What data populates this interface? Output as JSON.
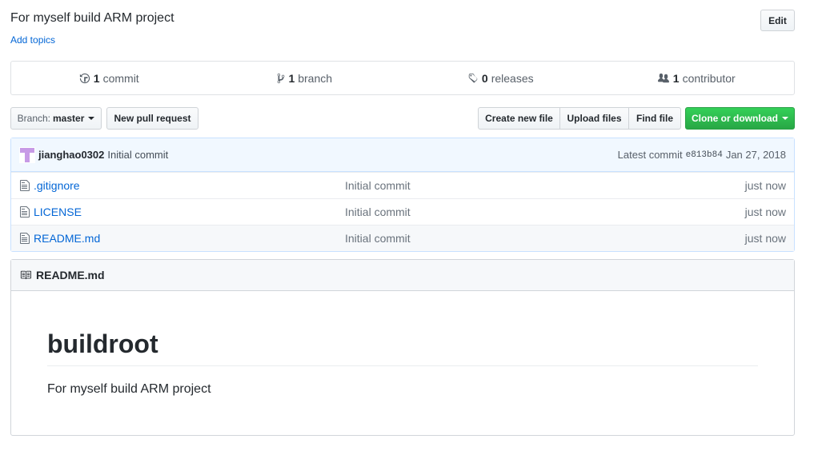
{
  "repo": {
    "description": "For myself build ARM project",
    "add_topics": "Add topics",
    "edit_label": "Edit"
  },
  "summary": {
    "commits_count": "1",
    "commits_label": "commit",
    "branches_count": "1",
    "branches_label": "branch",
    "releases_count": "0",
    "releases_label": "releases",
    "contributors_count": "1",
    "contributors_label": "contributor"
  },
  "toolbar": {
    "branch_prefix": "Branch:",
    "branch_name": "master",
    "new_pr": "New pull request",
    "create_file": "Create new file",
    "upload_files": "Upload files",
    "find_file": "Find file",
    "clone": "Clone or download"
  },
  "latest_commit": {
    "author": "jianghao0302",
    "message": "Initial commit",
    "label": "Latest commit",
    "sha": "e813b84",
    "date": "Jan 27, 2018"
  },
  "files": [
    {
      "name": ".gitignore",
      "message": "Initial commit",
      "age": "just now"
    },
    {
      "name": "LICENSE",
      "message": "Initial commit",
      "age": "just now"
    },
    {
      "name": "README.md",
      "message": "Initial commit",
      "age": "just now"
    }
  ],
  "readme": {
    "filename": "README.md",
    "heading": "buildroot",
    "body": "For myself build ARM project"
  },
  "colors": {
    "link": "#0366d6",
    "clone_green": "#28a745",
    "commit_bg": "#f1f8ff"
  }
}
